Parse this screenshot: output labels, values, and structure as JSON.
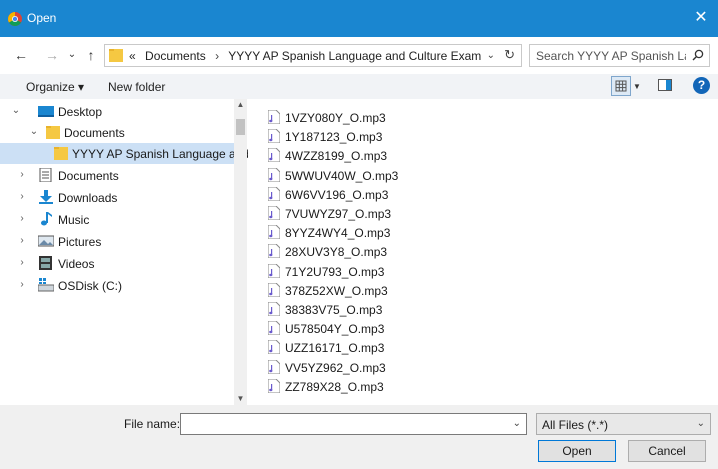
{
  "window": {
    "title": "Open",
    "close_glyph": "✕"
  },
  "nav": {
    "back": "←",
    "forward": "→",
    "recent": "⌄",
    "up": "↑"
  },
  "address": {
    "overflow": "«",
    "crumbs": [
      "Documents",
      "YYYY AP Spanish Language and Culture Exam"
    ],
    "separator": "›",
    "dropdown": "⌄",
    "refresh": "↻"
  },
  "search": {
    "placeholder": "Search YYYY AP Spanish Lang..."
  },
  "toolbar": {
    "organize": "Organize ▾",
    "new_folder": "New folder",
    "view_dropdown": "▼",
    "help": "?"
  },
  "tree": {
    "items": [
      {
        "label": "Desktop",
        "chev": "⌄",
        "icon": "desktop-icon"
      },
      {
        "label": "Documents",
        "chev": "⌄",
        "icon": "folder-icon"
      },
      {
        "label": "YYYY AP Spanish Language and C",
        "chev": "",
        "icon": "folder-icon"
      },
      {
        "label": "Documents",
        "chev": "›",
        "icon": "documents-icon"
      },
      {
        "label": "Downloads",
        "chev": "›",
        "icon": "downloads-icon"
      },
      {
        "label": "Music",
        "chev": "›",
        "icon": "music-icon"
      },
      {
        "label": "Pictures",
        "chev": "›",
        "icon": "pictures-icon"
      },
      {
        "label": "Videos",
        "chev": "›",
        "icon": "videos-icon"
      },
      {
        "label": "OSDisk (C:)",
        "chev": "›",
        "icon": "drive-icon"
      }
    ],
    "scroll_up": "▲",
    "scroll_down": "▼"
  },
  "files": [
    "1VZY080Y_O.mp3",
    "1Y187123_O.mp3",
    "4WZZ8199_O.mp3",
    "5WWUV40W_O.mp3",
    "6W6VV196_O.mp3",
    "7VUWYZ97_O.mp3",
    "8YYZ4WY4_O.mp3",
    "28XUV3Y8_O.mp3",
    "71Y2U793_O.mp3",
    "378Z52XW_O.mp3",
    "38383V75_O.mp3",
    "U578504Y_O.mp3",
    "UZZ16171_O.mp3",
    "VV5YZ962_O.mp3",
    "ZZ789X28_O.mp3"
  ],
  "bottom": {
    "file_name_label": "File name:",
    "file_name_value": "",
    "dropdown": "⌄",
    "filter": "All Files (*.*)",
    "open": "Open",
    "cancel": "Cancel"
  },
  "colors": {
    "titlebar": "#1a86d0",
    "selection": "#cce0f5",
    "folder": "#f5c842"
  }
}
